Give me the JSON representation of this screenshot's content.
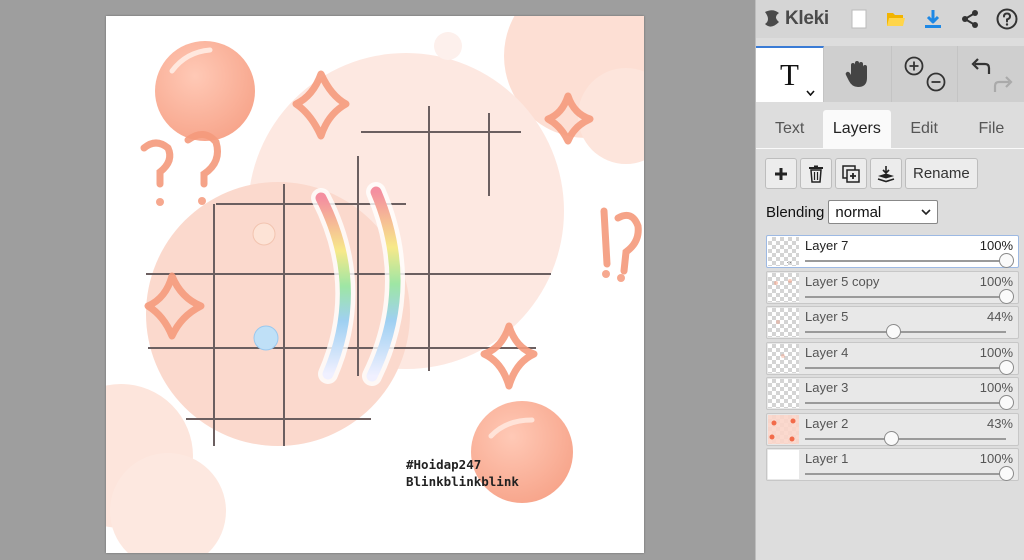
{
  "app": {
    "name": "Kleki"
  },
  "canvas": {
    "hashtag": "#Hoidap247",
    "caption": "Blinkblinkblink"
  },
  "toolbar": {
    "icons": [
      "new-file-icon",
      "open-folder-icon",
      "download-icon",
      "share-icon",
      "help-icon"
    ]
  },
  "tools": {
    "text_tool_label": "T",
    "icons": [
      "hand-icon",
      "zoom-in-icon",
      "zoom-out-icon",
      "undo-icon",
      "redo-icon"
    ]
  },
  "tabs": [
    {
      "label": "Text"
    },
    {
      "label": "Layers"
    },
    {
      "label": "Edit"
    },
    {
      "label": "File"
    }
  ],
  "layer_actions": {
    "rename_label": "Rename",
    "icons": [
      "add-layer-icon",
      "delete-layer-icon",
      "duplicate-layer-icon",
      "merge-down-icon"
    ]
  },
  "blending": {
    "label": "Blending",
    "value": "normal"
  },
  "layers": [
    {
      "name": "Layer 7",
      "opacity": "100%",
      "opacity_value": 1.0,
      "selected": true
    },
    {
      "name": "Layer 5 copy",
      "opacity": "100%",
      "opacity_value": 1.0,
      "selected": false
    },
    {
      "name": "Layer 5",
      "opacity": "44%",
      "opacity_value": 0.44,
      "selected": false
    },
    {
      "name": "Layer 4",
      "opacity": "100%",
      "opacity_value": 1.0,
      "selected": false
    },
    {
      "name": "Layer 3",
      "opacity": "100%",
      "opacity_value": 1.0,
      "selected": false
    },
    {
      "name": "Layer 2",
      "opacity": "43%",
      "opacity_value": 0.43,
      "selected": false
    },
    {
      "name": "Layer 1",
      "opacity": "100%",
      "opacity_value": 1.0,
      "selected": false
    }
  ],
  "colors": {
    "accent": "#3a7bd5",
    "peach": "#fbd5c9",
    "salmon": "#f59a7c",
    "download_blue": "#1e88e5"
  }
}
